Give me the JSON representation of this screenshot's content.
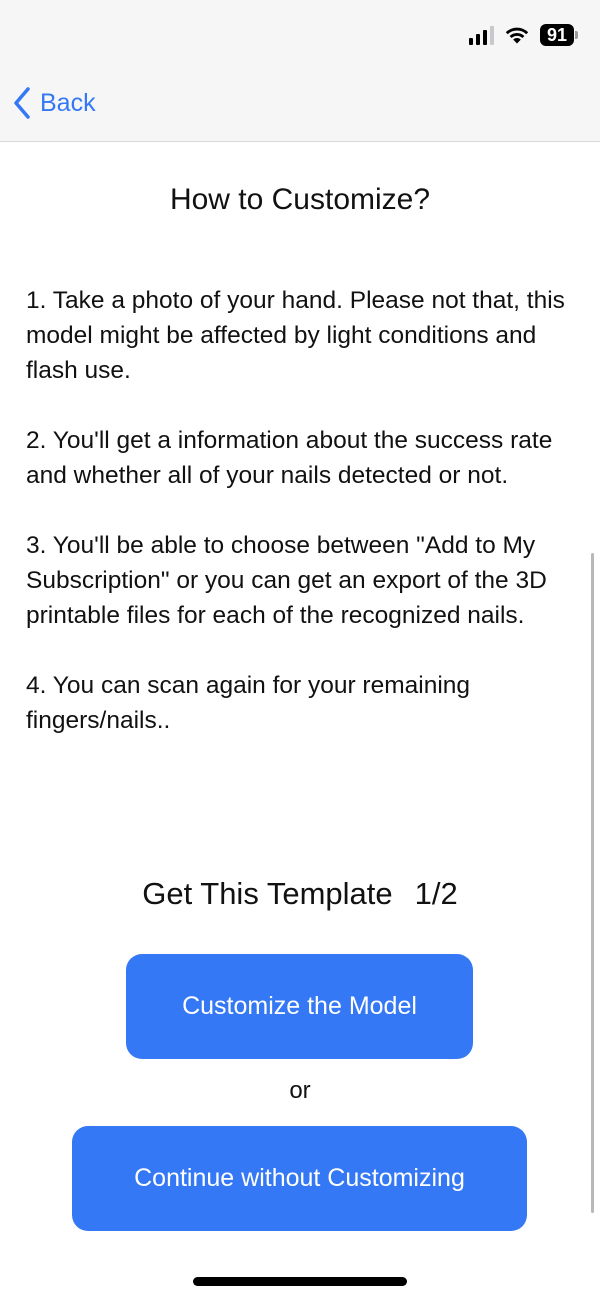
{
  "status_bar": {
    "battery_level": "91",
    "signal_bars_active": 3,
    "signal_bars_total": 4
  },
  "nav": {
    "back_label": "Back",
    "back_icon": "chevron-left-icon",
    "accent_color": "#3478f6"
  },
  "page": {
    "title": "How to Customize?",
    "steps": [
      "1. Take a photo of your hand. Please not that, this model might be affected by light conditions and flash use.",
      "2. You'll get a information about the success rate and whether all of your nails detected or not.",
      "3. You'll be able to choose between \"Add to My Subscription\" or you can get an export of the 3D printable files for each of the recognized nails.",
      "4. You can scan again for your remaining fingers/nails.."
    ],
    "template_label": "Get This Template",
    "template_count": "1/2",
    "customize_button_label": "Customize the Model",
    "or_label": "or",
    "continue_button_label": "Continue without Customizing"
  }
}
